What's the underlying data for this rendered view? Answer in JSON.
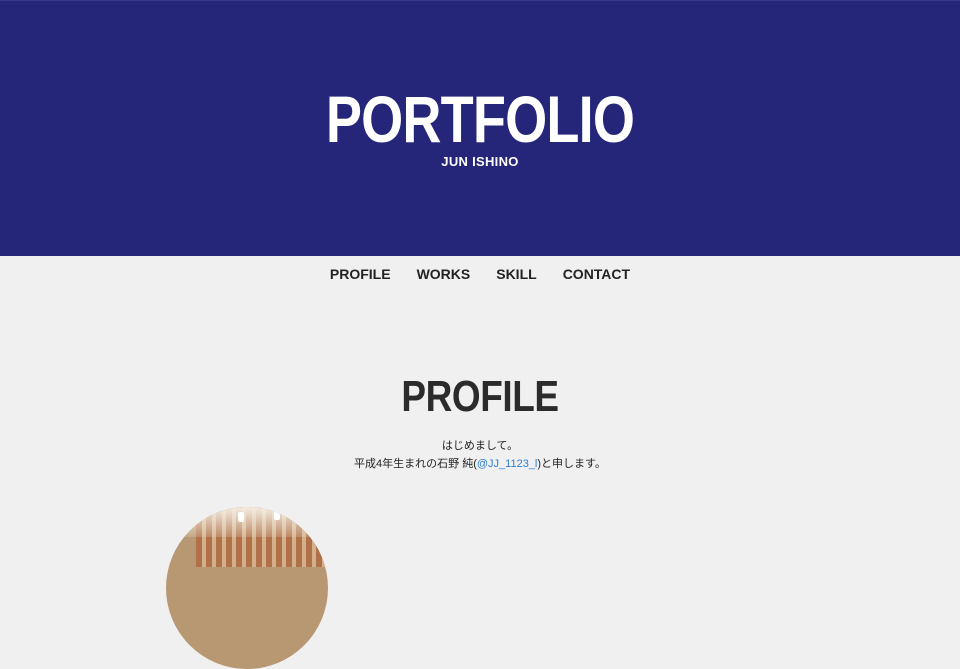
{
  "header": {
    "title": "PORTFOLIO",
    "subtitle": "JUN ISHINO"
  },
  "nav": {
    "items": [
      {
        "label": "PROFILE"
      },
      {
        "label": "WORKS"
      },
      {
        "label": "SKILL"
      },
      {
        "label": "CONTACT"
      }
    ]
  },
  "profile": {
    "heading": "PROFILE",
    "line1": "はじめまして。",
    "line2_prefix": "平成4年生まれの石野 純(",
    "twitter_handle": "@JJ_1123_l",
    "line2_suffix": ")と申します。"
  },
  "colors": {
    "hero_bg": "#25257a",
    "page_bg": "#f0f0f0",
    "link": "#2f7fd0"
  }
}
